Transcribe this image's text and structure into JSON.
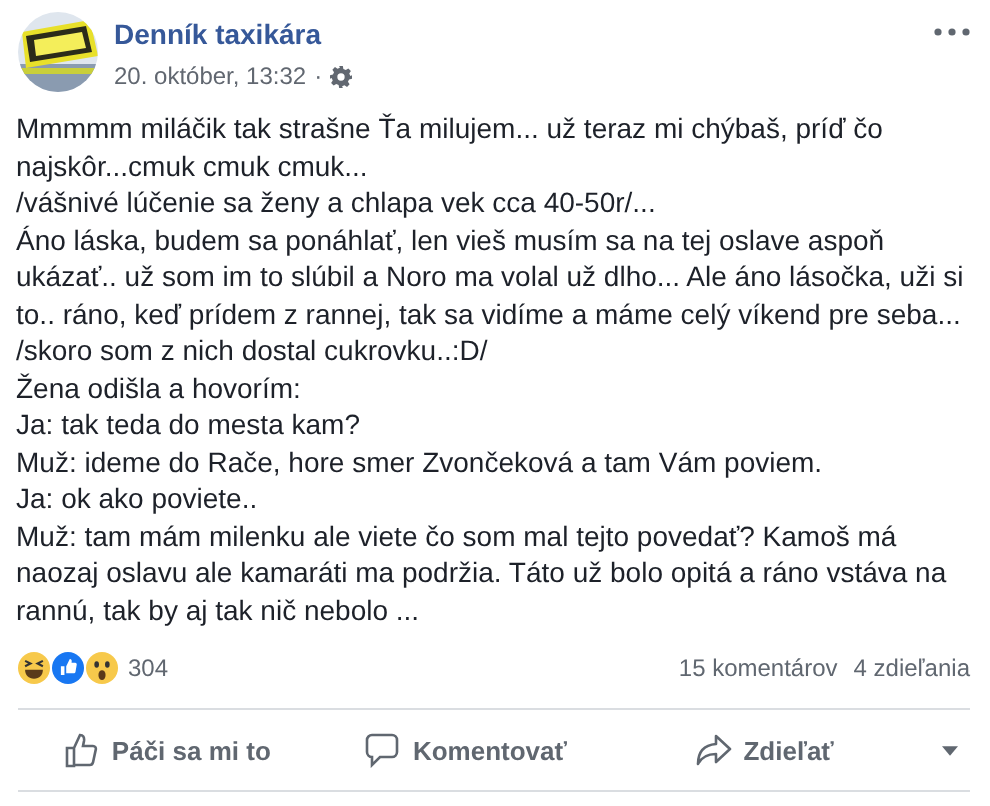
{
  "post": {
    "author": "Denník taxikára",
    "date": "20. október, 13:32",
    "separator": "·",
    "paragraphs": [
      "Mmmmm miláčik tak strašne Ťa milujem... už teraz mi chýbaš, príď čo najskôr...cmuk cmuk cmuk...",
      "/vášnivé lúčenie sa ženy a chlapa vek cca 40-50r/...",
      "Áno láska, budem sa ponáhlať, len vieš musím sa na tej oslave aspoň ukázať.. už som im to slúbil a Noro ma volal už dlho... Ale áno lásočka, uži si to.. ráno, keď prídem z rannej, tak sa vidíme a máme celý víkend pre seba...",
      "/skoro som z nich dostal cukrovku..:D/",
      "Žena odišla a hovorím:",
      "Ja: tak teda do mesta kam?",
      "Muž: ideme do Rače, hore smer Zvončeková a tam Vám poviem.",
      "Ja: ok ako poviete..",
      "Muž: tam mám milenku ale viete čo som mal tejto povedať? Kamoš má naozaj oslavu ale kamaráti ma podržia. Táto už bolo opitá a ráno vstáva na rannú, tak by aj tak nič nebolo ..."
    ]
  },
  "reactions": {
    "items": [
      {
        "kind": "haha"
      },
      {
        "kind": "like"
      },
      {
        "kind": "wow"
      }
    ],
    "count": "304",
    "comments": "15 komentárov",
    "shares": "4 zdieľania"
  },
  "actions": [
    {
      "kind": "like",
      "label": "Páči sa mi to"
    },
    {
      "kind": "comment",
      "label": "Komentovať"
    },
    {
      "kind": "share",
      "label": "Zdieľať"
    }
  ]
}
